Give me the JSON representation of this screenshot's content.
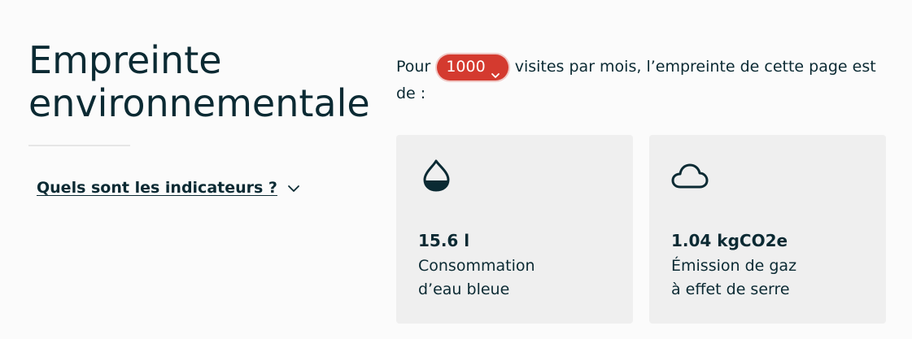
{
  "heading": {
    "line1": "Empreinte",
    "line2": "environnementale"
  },
  "indicators_link": {
    "label": "Quels sont les indicateurs ?",
    "icon": "chevron-down-icon"
  },
  "sentence": {
    "prefix": "Pour",
    "visits_select": {
      "value": "1000",
      "icon": "chevron-down-icon",
      "color": "#d43a2f"
    },
    "suffix": "visites par mois, l’empreinte de cette page est de :"
  },
  "cards": [
    {
      "icon": "water-drop-icon",
      "value": "15.6 l",
      "label_line1": "Consommation",
      "label_line2": "d’eau bleue"
    },
    {
      "icon": "cloud-icon",
      "value": "1.04 kgCO2e",
      "label_line1": "Émission de gaz",
      "label_line2": "à effet de serre"
    }
  ]
}
